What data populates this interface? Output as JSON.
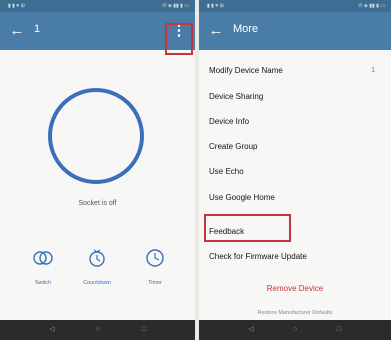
{
  "left_screen": {
    "title": "1",
    "status": "Socket is off",
    "controls": [
      {
        "label": "Switch",
        "icon": "switch-icon"
      },
      {
        "label": "Countdown",
        "icon": "countdown-icon"
      },
      {
        "label": "Timer",
        "icon": "timer-icon"
      }
    ]
  },
  "right_screen": {
    "title": "More",
    "menu": [
      {
        "label": "Modify Device Name",
        "value": "1"
      },
      {
        "label": "Device Sharing"
      },
      {
        "label": "Device Info"
      },
      {
        "label": "Create Group"
      },
      {
        "label": "Use Echo"
      },
      {
        "label": "Use Google Home"
      },
      {
        "label": "Feedback",
        "highlighted": true
      },
      {
        "label": "Check for Firmware Update"
      }
    ],
    "remove_label": "Remove Device",
    "restore_label": "Restore Manufacturer Defaults"
  },
  "colors": {
    "app_bar": "#4a7ca8",
    "accent_blue": "#3b6fbc",
    "highlight_red": "#c8343a",
    "nav_bar": "#2b2b2b"
  }
}
